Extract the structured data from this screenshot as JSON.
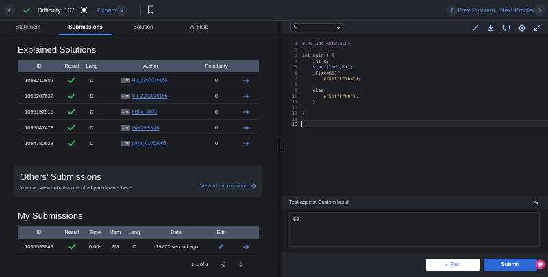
{
  "topbar": {
    "difficulty": "Difficulty: 167",
    "expand_label": "Expand",
    "prev_label": "Prev Problem",
    "next_label": "Next Problem"
  },
  "tabs": [
    {
      "label": "Statement"
    },
    {
      "label": "Submissions"
    },
    {
      "label": "Solution"
    },
    {
      "label": "AI Help"
    }
  ],
  "explained": {
    "title": "Explained Solutions",
    "headers": [
      "ID",
      "Result",
      "Lang",
      "Author",
      "Popularity"
    ],
    "rows": [
      {
        "id": "1093210802",
        "lang": "C",
        "badge": "1 ★",
        "author": "klu_2200039168",
        "popularity": "0"
      },
      {
        "id": "1093207632",
        "lang": "C",
        "badge": "1 ★",
        "author": "klu_2200039166",
        "popularity": "0"
      },
      {
        "id": "1095192515",
        "lang": "C",
        "badge": "1 ★",
        "author": "trisha_0405",
        "popularity": "0"
      },
      {
        "id": "1095047478",
        "lang": "C",
        "badge": "1 ★",
        "author": "rajaduraisuju",
        "popularity": "0"
      },
      {
        "id": "1094780628",
        "lang": "C",
        "badge": "1 ★",
        "author": "priya_01052005",
        "popularity": "0"
      }
    ]
  },
  "others": {
    "title": "Others' Submissions",
    "subtitle": "You can view submissions of all participants here",
    "link": "View all submissions"
  },
  "my": {
    "title": "My Submissions",
    "headers": [
      "ID",
      "Result",
      "Time",
      "Mem",
      "Lang",
      "Date",
      "Edit"
    ],
    "rows": [
      {
        "id": "1095593849",
        "time": "0.00s",
        "mem": "2M",
        "lang": "C",
        "date": "-19777 second ago"
      }
    ],
    "pagination": "1-1 of 1"
  },
  "editor": {
    "language": "C",
    "line_numbers": [
      "1",
      "2",
      "3",
      "4",
      "5",
      "6",
      "7",
      "8",
      "9",
      "10",
      "11",
      "12",
      "13",
      "14",
      "15"
    ],
    "lines": [
      "#include <stdio.h>",
      "",
      "int main() {",
      "    int x;",
      "    scanf(\"%d\",&x);",
      "    if(x<=60){",
      "        printf(\"YES\");",
      "    }",
      "    else{",
      "        printf(\"NO\");",
      "    }",
      "",
      "}",
      "",
      ""
    ]
  },
  "custom_input": {
    "title": "Test against Custom Input",
    "value": "60"
  },
  "actions": {
    "run": "Run",
    "submit": "Submit"
  },
  "colors": {
    "accent": "#4e87f5",
    "success": "#3fbf5a",
    "link": "#5b8ee6"
  }
}
